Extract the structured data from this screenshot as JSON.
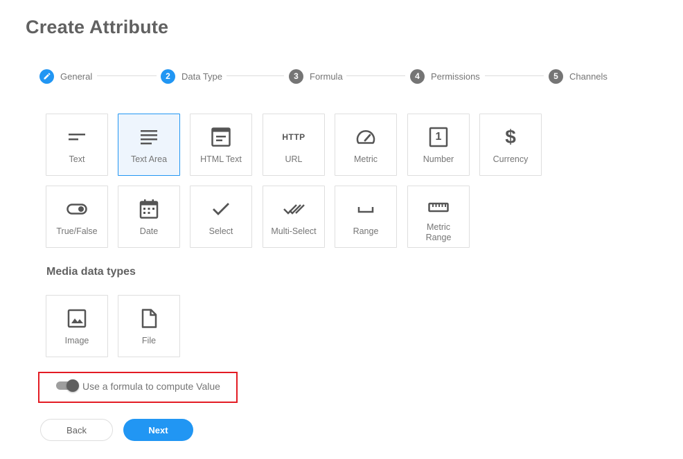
{
  "page": {
    "title": "Create Attribute"
  },
  "stepper": {
    "steps": [
      {
        "number": "",
        "label": "General",
        "state": "completed",
        "icon": "pencil-icon"
      },
      {
        "number": "2",
        "label": "Data Type",
        "state": "active"
      },
      {
        "number": "3",
        "label": "Formula",
        "state": "inactive"
      },
      {
        "number": "4",
        "label": "Permissions",
        "state": "inactive"
      },
      {
        "number": "5",
        "label": "Channels",
        "state": "inactive"
      }
    ]
  },
  "data_types": [
    {
      "label": "Text",
      "icon": "short-text-icon",
      "selected": false
    },
    {
      "label": "Text Area",
      "icon": "notes-icon",
      "selected": true
    },
    {
      "label": "HTML Text",
      "icon": "web-page-icon",
      "selected": false
    },
    {
      "label": "URL",
      "icon": "http-icon",
      "icon_text": "HTTP",
      "selected": false
    },
    {
      "label": "Metric",
      "icon": "speedometer-icon",
      "selected": false
    },
    {
      "label": "Number",
      "icon": "number-box-icon",
      "icon_text": "1",
      "selected": false
    },
    {
      "label": "Currency",
      "icon": "dollar-icon",
      "icon_text": "$",
      "selected": false
    },
    {
      "label": "True/False",
      "icon": "toggle-icon",
      "selected": false
    },
    {
      "label": "Date",
      "icon": "calendar-icon",
      "selected": false
    },
    {
      "label": "Select",
      "icon": "check-icon",
      "selected": false
    },
    {
      "label": "Multi-Select",
      "icon": "double-check-icon",
      "selected": false
    },
    {
      "label": "Range",
      "icon": "range-bracket-icon",
      "selected": false
    },
    {
      "label": "Metric Range",
      "icon": "ruler-icon",
      "selected": false
    }
  ],
  "media": {
    "title": "Media data types",
    "types": [
      {
        "label": "Image",
        "icon": "image-icon"
      },
      {
        "label": "File",
        "icon": "file-icon"
      }
    ]
  },
  "formula": {
    "label": "Use a formula to compute Value",
    "enabled": false
  },
  "actions": {
    "back": "Back",
    "next": "Next"
  },
  "colors": {
    "accent": "#2196f3",
    "highlight_box": "#e31b23",
    "text": "#616161",
    "inactive_step": "#757575"
  }
}
